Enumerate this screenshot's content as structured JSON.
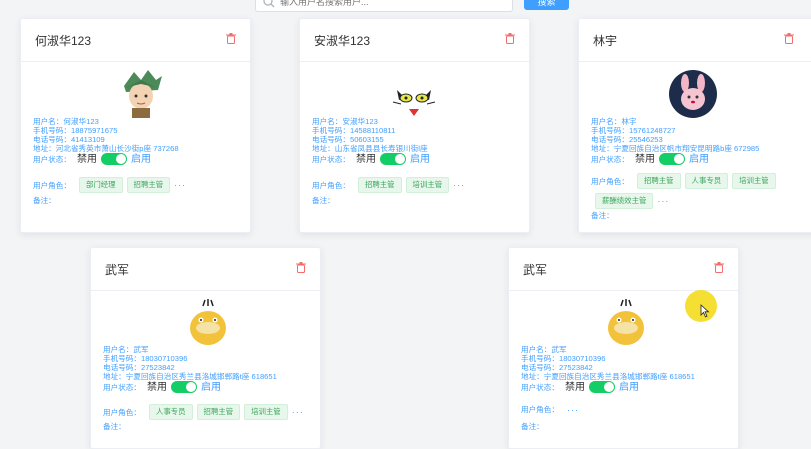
{
  "search": {
    "placeholder": "输入用户名搜索用户...",
    "button_label": "搜索"
  },
  "labels": {
    "username": "用户名：",
    "phone": "手机号码：",
    "tel": "电话号码：",
    "address": "地址：",
    "status": "用户状态：",
    "disable": "禁用",
    "enable": "启用",
    "roles": "用户角色：",
    "note": "备注：",
    "more": "···"
  },
  "cards": [
    {
      "name": "何淑华123",
      "username": "何淑华123",
      "phone": "18875971675",
      "tel": "41413109",
      "address": "河北省秀英市萧山长沙街p座 737268",
      "roles": [
        "部门经理",
        "招聘主管"
      ],
      "avatar": "anime-warrior-avatar"
    },
    {
      "name": "安淑华123",
      "username": "安淑华123",
      "phone": "14588110811",
      "tel": "50603155",
      "address": "山东省凤县县长寿银川街l座",
      "roles": [
        "招聘主管",
        "培训主管"
      ],
      "avatar": "cat-face-avatar"
    },
    {
      "name": "林宇",
      "username": "林宇",
      "phone": "15761248727",
      "tel": "25546253",
      "address": "宁夏回族自治区帆市翔安昆明路b座 672985",
      "roles": [
        "招聘主管",
        "人事专员",
        "培训主管",
        "薪酬绩效主管"
      ],
      "avatar": "rabbit-avatar"
    },
    {
      "name": "武军",
      "username": "武军",
      "phone": "18030710396",
      "tel": "27523842",
      "address": "宁夏回族自治区秀兰县洛城邯郸路t座 618651",
      "roles": [
        "人事专员",
        "招聘主管",
        "培训主管"
      ],
      "avatar": "yellow-duck-avatar"
    },
    {
      "name": "武军",
      "username": "武军",
      "phone": "18030710396",
      "tel": "27523842",
      "address": "宁夏回族自治区秀兰县洛城邯郸路t座 618651",
      "roles": [],
      "avatar": "yellow-duck-avatar"
    }
  ],
  "colors": {
    "accent": "#409eff",
    "toggle_on": "#13ce66",
    "tag_bg": "#e8f7ec",
    "delete": "#f56c6c"
  }
}
